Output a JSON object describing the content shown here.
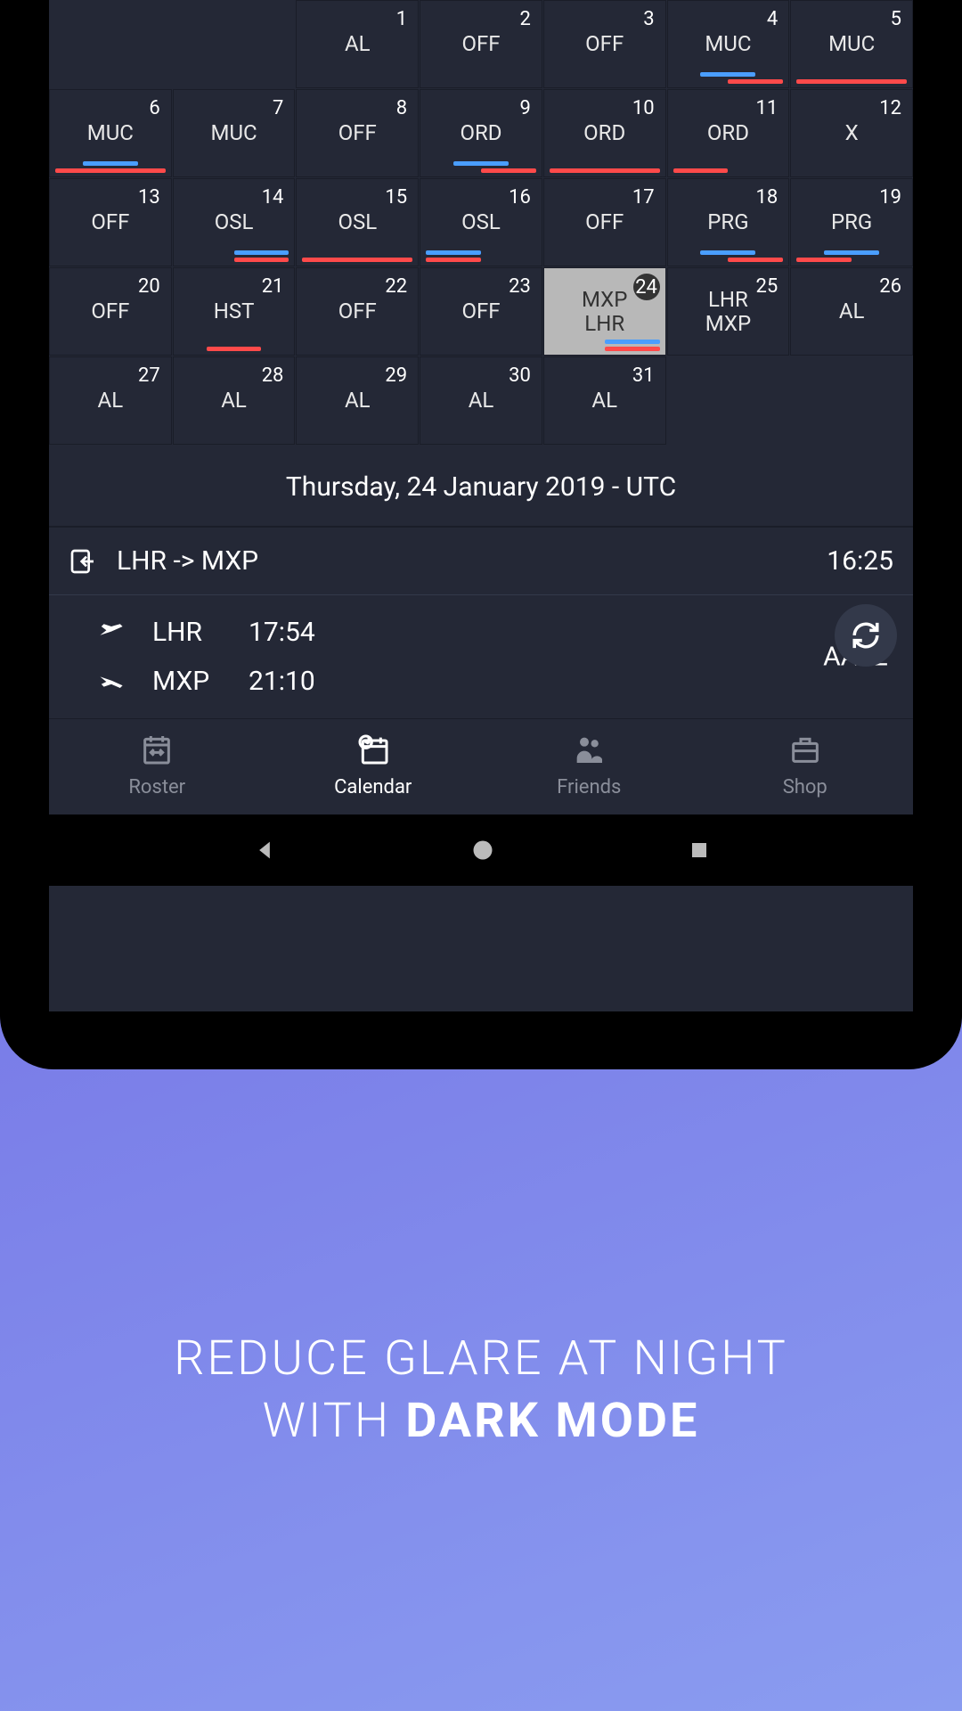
{
  "calendar": {
    "cells": [
      {
        "day": "",
        "codes": [],
        "empty": true
      },
      {
        "day": "",
        "codes": [],
        "empty": true
      },
      {
        "day": "1",
        "codes": [
          "AL"
        ]
      },
      {
        "day": "2",
        "codes": [
          "OFF"
        ]
      },
      {
        "day": "3",
        "codes": [
          "OFF"
        ]
      },
      {
        "day": "4",
        "codes": [
          "MUC"
        ],
        "bars": [
          {
            "cls": "blue short"
          },
          {
            "cls": "red right"
          }
        ]
      },
      {
        "day": "5",
        "codes": [
          "MUC"
        ],
        "bars": [
          {
            "cls": "red full"
          }
        ]
      },
      {
        "day": "6",
        "codes": [
          "MUC"
        ],
        "bars": [
          {
            "cls": "blue short"
          },
          {
            "cls": "red full"
          }
        ]
      },
      {
        "day": "7",
        "codes": [
          "MUC"
        ]
      },
      {
        "day": "8",
        "codes": [
          "OFF"
        ]
      },
      {
        "day": "9",
        "codes": [
          "ORD"
        ],
        "bars": [
          {
            "cls": "blue short"
          },
          {
            "cls": "red right"
          }
        ]
      },
      {
        "day": "10",
        "codes": [
          "ORD"
        ],
        "bars": [
          {
            "cls": "red full"
          }
        ]
      },
      {
        "day": "11",
        "codes": [
          "ORD"
        ],
        "bars": [
          {
            "cls": "red left"
          }
        ]
      },
      {
        "day": "12",
        "codes": [
          "X"
        ]
      },
      {
        "day": "13",
        "codes": [
          "OFF"
        ]
      },
      {
        "day": "14",
        "codes": [
          "OSL"
        ],
        "bars": [
          {
            "cls": "blue right"
          },
          {
            "cls": "red right"
          }
        ]
      },
      {
        "day": "15",
        "codes": [
          "OSL"
        ],
        "bars": [
          {
            "cls": "red full"
          }
        ]
      },
      {
        "day": "16",
        "codes": [
          "OSL"
        ],
        "bars": [
          {
            "cls": "blue left"
          },
          {
            "cls": "red left"
          }
        ]
      },
      {
        "day": "17",
        "codes": [
          "OFF"
        ]
      },
      {
        "day": "18",
        "codes": [
          "PRG"
        ],
        "bars": [
          {
            "cls": "blue short"
          },
          {
            "cls": "red right"
          }
        ]
      },
      {
        "day": "19",
        "codes": [
          "PRG"
        ],
        "bars": [
          {
            "cls": "blue short"
          },
          {
            "cls": "red left"
          }
        ]
      },
      {
        "day": "20",
        "codes": [
          "OFF"
        ]
      },
      {
        "day": "21",
        "codes": [
          "HST"
        ],
        "bars": [
          {
            "cls": "red short"
          }
        ]
      },
      {
        "day": "22",
        "codes": [
          "OFF"
        ]
      },
      {
        "day": "23",
        "codes": [
          "OFF"
        ]
      },
      {
        "day": "24",
        "codes": [
          "MXP",
          "LHR"
        ],
        "selected": true,
        "bars": [
          {
            "cls": "blue right"
          },
          {
            "cls": "red right"
          }
        ]
      },
      {
        "day": "25",
        "codes": [
          "LHR",
          "MXP"
        ]
      },
      {
        "day": "26",
        "codes": [
          "AL"
        ]
      },
      {
        "day": "27",
        "codes": [
          "AL"
        ]
      },
      {
        "day": "28",
        "codes": [
          "AL"
        ]
      },
      {
        "day": "29",
        "codes": [
          "AL"
        ]
      },
      {
        "day": "30",
        "codes": [
          "AL"
        ]
      },
      {
        "day": "31",
        "codes": [
          "AL"
        ]
      },
      {
        "day": "",
        "codes": [],
        "empty": true
      },
      {
        "day": "",
        "codes": [],
        "empty": true
      }
    ]
  },
  "dateHeader": "Thursday, 24 January 2019 - UTC",
  "flight": {
    "route": "LHR -> MXP",
    "reportTime": "16:25",
    "legs": [
      {
        "type": "dep",
        "code": "LHR",
        "time": "17:54"
      },
      {
        "type": "arr",
        "code": "MXP",
        "time": "21:10"
      }
    ],
    "flightNo": "AA22"
  },
  "nav": [
    {
      "label": "Roster",
      "icon": "roster"
    },
    {
      "label": "Calendar",
      "icon": "calendar",
      "active": true
    },
    {
      "label": "Friends",
      "icon": "friends"
    },
    {
      "label": "Shop",
      "icon": "shop"
    }
  ],
  "promo": {
    "line1": "REDUCE GLARE AT NIGHT",
    "line2a": "WITH ",
    "line2b": "DARK MODE"
  }
}
